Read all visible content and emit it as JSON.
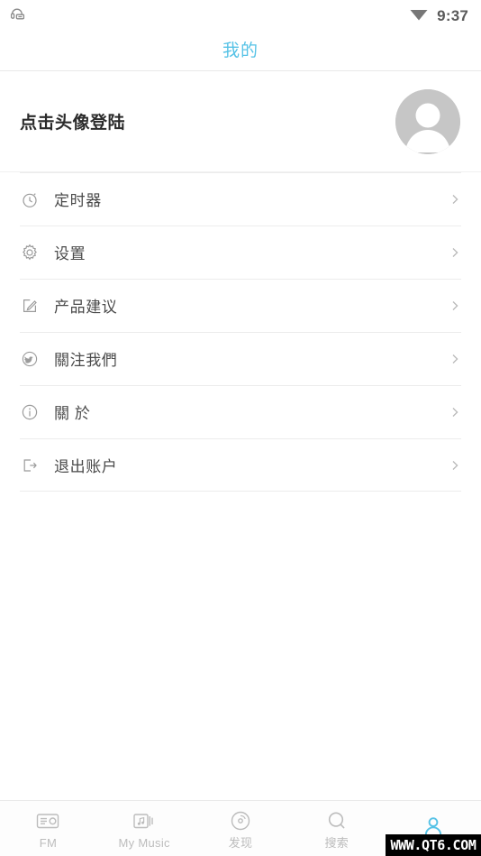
{
  "status_bar": {
    "left_icon": "headset-notification-icon",
    "wifi_icon": "wifi-icon",
    "time": "9:37"
  },
  "title_bar": {
    "title": "我的",
    "accent_color": "#55c2e6"
  },
  "profile": {
    "login_prompt": "点击头像登陆",
    "avatar_icon": "default-avatar-person-icon",
    "avatar_bg_color": "#c6c6c6"
  },
  "menu": {
    "items": [
      {
        "icon": "timer-icon",
        "label": "定时器",
        "chevron": "chevron-right-icon"
      },
      {
        "icon": "gear-icon",
        "label": "设置",
        "chevron": "chevron-right-icon"
      },
      {
        "icon": "edit-icon",
        "label": "产品建议",
        "chevron": "chevron-right-icon"
      },
      {
        "icon": "bird-circle-icon",
        "label": "關注我們",
        "chevron": "chevron-right-icon"
      },
      {
        "icon": "info-icon",
        "label": "關 於",
        "chevron": "chevron-right-icon"
      },
      {
        "icon": "logout-icon",
        "label": "退出账户",
        "chevron": "chevron-right-icon"
      }
    ]
  },
  "tab_bar": {
    "tabs": [
      {
        "icon": "radio-icon",
        "label": "FM",
        "active": false
      },
      {
        "icon": "music-card-icon",
        "label": "My Music",
        "active": false
      },
      {
        "icon": "disc-icon",
        "label": "发现",
        "active": false
      },
      {
        "icon": "search-icon",
        "label": "搜索",
        "active": false
      },
      {
        "icon": "person-icon",
        "label": "",
        "active": true
      }
    ],
    "active_color": "#55c2e6",
    "inactive_color": "#bcbcbc"
  },
  "watermark": {
    "text": "WWW.QT6.COM"
  }
}
